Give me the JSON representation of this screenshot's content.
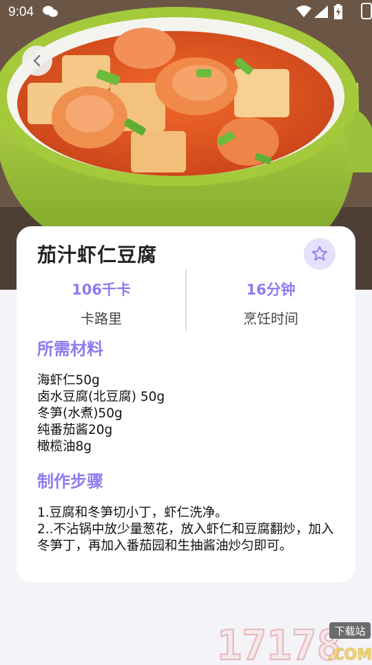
{
  "status_bar": {
    "time": "9:04"
  },
  "recipe": {
    "title": "茄汁虾仁豆腐",
    "calories_value": "106千卡",
    "calories_label": "卡路里",
    "time_value": "16分钟",
    "time_label": "烹饪时间"
  },
  "ingredients": {
    "heading": "所需材料",
    "items": [
      "海虾仁50g",
      "卤水豆腐(北豆腐) 50g",
      "冬笋(水煮)50g",
      "纯番茄酱20g",
      "橄榄油8g"
    ]
  },
  "steps": {
    "heading": "制作步骤",
    "items": [
      "1.豆腐和冬笋切小丁，虾仁洗净。",
      "2..不沾锅中放少量葱花，放入虾仁和豆腐翻炒，加入冬笋丁，再加入番茄园和生抽酱油炒匀即可。"
    ]
  },
  "watermark": {
    "number": "17178",
    "badge": "下载站",
    "suffix": ".COM"
  },
  "colors": {
    "accent": "#8b7cf0",
    "fav_bg": "#e3e1fb",
    "background": "#f3f3f8",
    "bowl_green": "#a4c93a"
  }
}
